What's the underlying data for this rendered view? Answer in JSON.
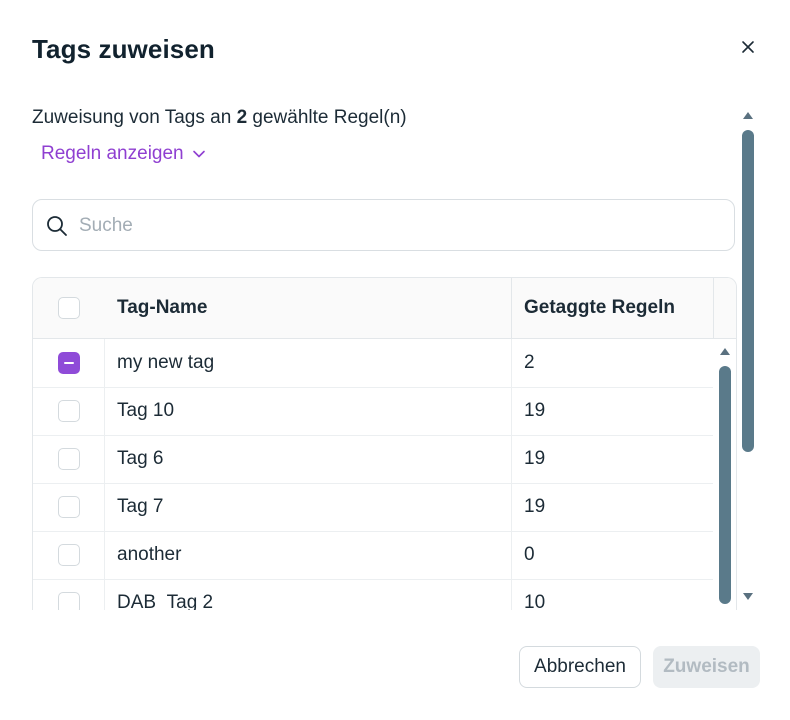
{
  "dialog": {
    "title": "Tags zuweisen",
    "description_prefix": "Zuweisung von Tags an ",
    "selected_count": "2",
    "description_suffix": " gewählte Regel(n)",
    "show_rules_label": "Regeln anzeigen"
  },
  "search": {
    "placeholder": "Suche",
    "value": ""
  },
  "table": {
    "columns": [
      "Tag-Name",
      "Getaggte Regeln"
    ],
    "rows": [
      {
        "name": "my new tag",
        "count": "2",
        "state": "indeterminate"
      },
      {
        "name": "Tag 10",
        "count": "19",
        "state": "unchecked"
      },
      {
        "name": "Tag 6",
        "count": "19",
        "state": "unchecked"
      },
      {
        "name": "Tag 7",
        "count": "19",
        "state": "unchecked"
      },
      {
        "name": "another",
        "count": "0",
        "state": "unchecked"
      },
      {
        "name": "DAB_Tag 2",
        "count": "10",
        "state": "unchecked"
      }
    ]
  },
  "footer": {
    "cancel_label": "Abbrechen",
    "assign_label": "Zuweisen",
    "assign_disabled": true
  },
  "colors": {
    "accent": "#8f4bd8",
    "text": "#1c2b36",
    "scrollbar": "#5a7a8a"
  },
  "icons": {
    "close": "close-icon",
    "chevron": "chevron-down-icon",
    "search": "search-icon"
  }
}
